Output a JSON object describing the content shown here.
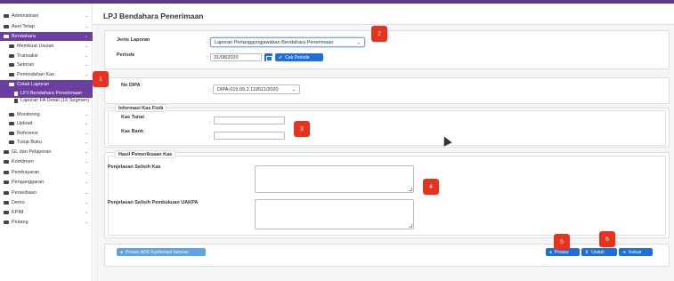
{
  "page": {
    "title": "LPJ Bendahara Penerimaan"
  },
  "sidebar": {
    "items": [
      {
        "label": "Administrasi",
        "chev": "⌄"
      },
      {
        "label": "Aset Tetap",
        "chev": "⌄"
      },
      {
        "label": "Bendahara",
        "chev": "⌄"
      },
      {
        "label": "Membuat Usulan",
        "chev": "⌄"
      },
      {
        "label": "Transaksi",
        "chev": "⌄"
      },
      {
        "label": "Setoran",
        "chev": "⌄"
      },
      {
        "label": "Pemindahan Kas",
        "chev": "⌄"
      },
      {
        "label": "Cetak Laporan",
        "chev": "⌃"
      },
      {
        "label": "LPJ Bendahara Penerimaan"
      },
      {
        "label": "Laporan FA Detail (16 Segmen)"
      },
      {
        "label": "Monitoring",
        "chev": "⌄"
      },
      {
        "label": "Upload",
        "chev": "⌄"
      },
      {
        "label": "Referensi",
        "chev": "⌄"
      },
      {
        "label": "Tutup Buku",
        "chev": "⌄"
      },
      {
        "label": "GL dan Pelaporan",
        "chev": "⌄"
      },
      {
        "label": "Komitmen",
        "chev": "⌄"
      },
      {
        "label": "Pembayaran",
        "chev": "⌄"
      },
      {
        "label": "Penganggaran",
        "chev": "⌄"
      },
      {
        "label": "Persediaan",
        "chev": "⌄"
      },
      {
        "label": "Demo",
        "chev": "⌄"
      },
      {
        "label": "KPIM",
        "chev": "⌄"
      },
      {
        "label": "Piutang",
        "chev": "⌄"
      }
    ]
  },
  "form": {
    "jenis_label": "Jenis Laporan",
    "jenis_value": "Laporan Pertanggungjawaban Bendahara Penerimaan",
    "periode_label": "Periode",
    "periode_value": "31/08/2020",
    "cek_periode": "Cek Periode",
    "dipa_label": "No DIPA",
    "dipa_value": "DIPA-015.09.2.119511/2020",
    "kas_legend": "Informasi Kas Fisik",
    "kas_tunai_label": "Kas Tunai",
    "kas_bank_label": "Kas Bank",
    "hasil_legend": "Hasil Pemeriksaan Kas",
    "selisih_kas_label": "Penjelasan Selisih Kas",
    "selisih_uakpa_label": "Penjelasan Selisih Pembukuan UAKPA",
    "colon": ":"
  },
  "footer": {
    "proses_adk": "Proses ADK Konfirmasi Setoran",
    "proses": "Proses",
    "unduh": "Unduh",
    "keluar": "Keluar"
  },
  "markers": [
    "1",
    "2",
    "3",
    "4",
    "5",
    "6"
  ],
  "colors": {
    "accent": "#1e6fd9",
    "sidebar_active": "#6b3fa0",
    "marker": "#e8321e"
  }
}
